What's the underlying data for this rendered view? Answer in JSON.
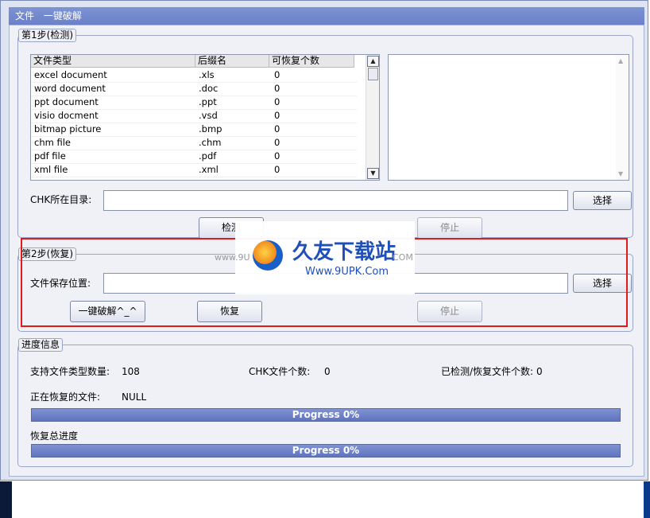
{
  "menubar": {
    "items": [
      "文件",
      "一键破解"
    ]
  },
  "step1": {
    "legend": "第1步(检测)",
    "columns": [
      "文件类型",
      "后缀名",
      "可恢复个数"
    ],
    "rows": [
      {
        "type": "excel document",
        "ext": ".xls",
        "count": "0"
      },
      {
        "type": "word document",
        "ext": ".doc",
        "count": "0"
      },
      {
        "type": "ppt document",
        "ext": ".ppt",
        "count": "0"
      },
      {
        "type": "visio docment",
        "ext": ".vsd",
        "count": "0"
      },
      {
        "type": "bitmap picture",
        "ext": ".bmp",
        "count": "0"
      },
      {
        "type": "chm file",
        "ext": ".chm",
        "count": "0"
      },
      {
        "type": "pdf file",
        "ext": ".pdf",
        "count": "0"
      },
      {
        "type": "xml file",
        "ext": ".xml",
        "count": "0"
      }
    ],
    "chk_dir_label": "CHK所在目录:",
    "chk_dir_value": "",
    "select_label": "选择",
    "detect_label": "检测",
    "stop_label": "停止"
  },
  "step2": {
    "legend": "第2步(恢复)",
    "save_label": "文件保存位置:",
    "save_value": "",
    "select_label": "选择",
    "oneclick_label": "一键破解^_^",
    "recover_label": "恢复",
    "stop_label": "停止"
  },
  "progress": {
    "legend": "进度信息",
    "types_label": "支持文件类型数量:",
    "types_value": "108",
    "chk_count_label": "CHK文件个数:",
    "chk_count_value": "0",
    "detected_label": "已检测/恢复文件个数:",
    "detected_value": "0",
    "current_label": "正在恢复的文件:",
    "current_value": "NULL",
    "bar1_text": "Progress 0%",
    "total_label": "恢复总进度",
    "bar2_text": "Progress 0%",
    "bar1_fraction": 0,
    "bar2_fraction": 0
  },
  "watermark": {
    "title": "久友下载站",
    "url": "Www.9UPK.Com",
    "left_text": "www.9U",
    "right_text": "COM"
  },
  "colors": {
    "accent": "#6b80c9",
    "highlight_box": "#e21a1a",
    "progress": "#6d82c8"
  }
}
